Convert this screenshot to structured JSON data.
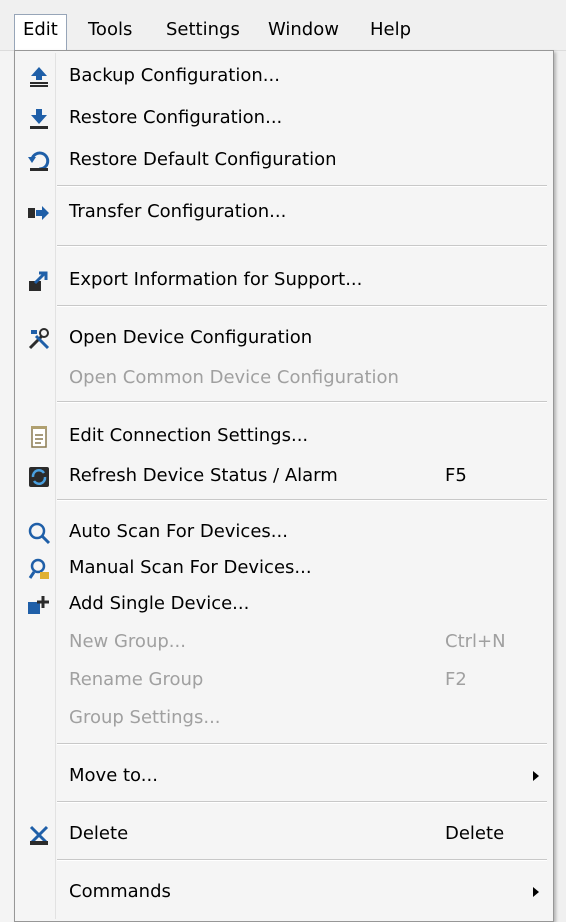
{
  "menubar": {
    "items": [
      "Edit",
      "Tools",
      "Settings",
      "Window",
      "Help"
    ],
    "open": "Edit"
  },
  "menu": {
    "items": [
      {
        "label": "Backup Configuration...",
        "icon": "backup-up-arrow-icon",
        "enabled": true
      },
      {
        "label": "Restore Configuration...",
        "icon": "restore-down-arrow-icon",
        "enabled": true
      },
      {
        "label": "Restore Default Configuration",
        "icon": "restore-default-icon",
        "enabled": true
      },
      {
        "label": "Transfer Configuration...",
        "icon": "transfer-icon",
        "enabled": true
      },
      {
        "label": "Export Information for Support...",
        "icon": "export-icon",
        "enabled": true
      },
      {
        "label": "Open Device Configuration",
        "icon": "tools-icon",
        "enabled": true
      },
      {
        "label": "Open Common Device Configuration",
        "icon": "",
        "enabled": false
      },
      {
        "label": "Edit Connection Settings...",
        "icon": "document-icon",
        "enabled": true
      },
      {
        "label": "Refresh Device Status / Alarm",
        "shortcut": "F5",
        "icon": "refresh-icon",
        "enabled": true
      },
      {
        "label": "Auto Scan For Devices...",
        "icon": "magnifier-icon",
        "enabled": true
      },
      {
        "label": "Manual Scan For Devices...",
        "icon": "manual-scan-icon",
        "enabled": true
      },
      {
        "label": "Add Single Device...",
        "icon": "add-device-icon",
        "enabled": true
      },
      {
        "label": "New Group...",
        "shortcut": "Ctrl+N",
        "enabled": false
      },
      {
        "label": "Rename Group",
        "shortcut": "F2",
        "enabled": false
      },
      {
        "label": "Group Settings...",
        "enabled": false
      },
      {
        "label": "Move to...",
        "submenu": true,
        "enabled": true
      },
      {
        "label": "Delete",
        "shortcut": "Delete",
        "icon": "delete-icon",
        "enabled": true
      },
      {
        "label": "Commands",
        "submenu": true,
        "enabled": true
      }
    ]
  },
  "colors": {
    "menu_background": "#f5f5f5",
    "disabled_text": "#a0a0a0",
    "icon_blue": "#1f5fa8",
    "icon_dark": "#2b2b2b"
  }
}
